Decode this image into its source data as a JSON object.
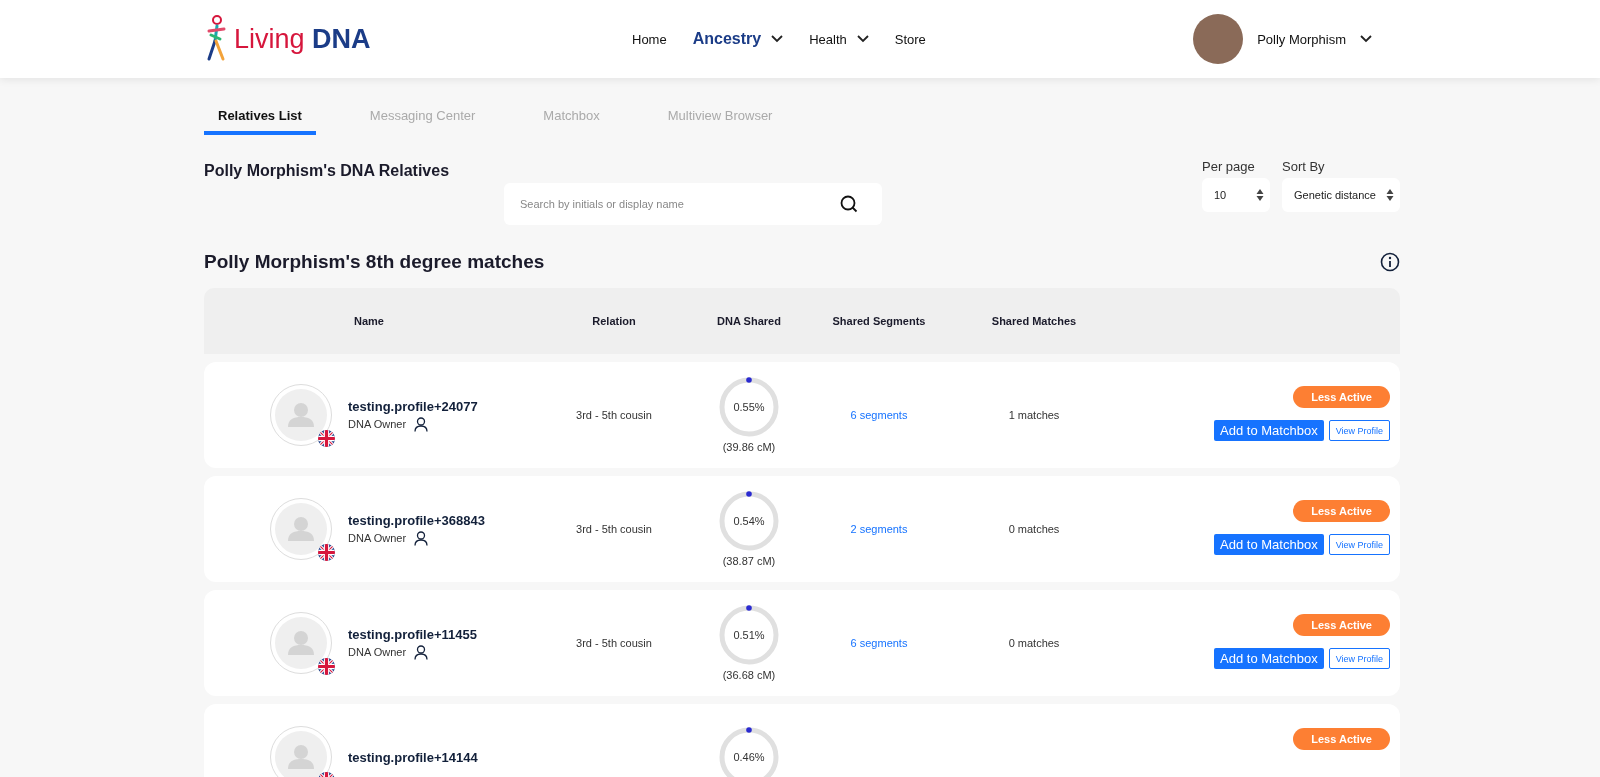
{
  "header": {
    "logo": {
      "word_1": "Living",
      "word_2": "DNA"
    },
    "nav": [
      {
        "label": "Home",
        "selected": false,
        "dropdown": false
      },
      {
        "label": "Ancestry",
        "selected": true,
        "dropdown": true
      },
      {
        "label": "Health",
        "selected": false,
        "dropdown": true
      },
      {
        "label": "Store",
        "selected": false,
        "dropdown": false
      }
    ],
    "user": {
      "name": "Polly Morphism"
    }
  },
  "tabs": [
    {
      "label": "Relatives List",
      "selected": true
    },
    {
      "label": "Messaging Center",
      "selected": false
    },
    {
      "label": "Matchbox",
      "selected": false
    },
    {
      "label": "Multiview Browser",
      "selected": false
    }
  ],
  "relatives_title": "Polly Morphism's DNA Relatives",
  "search": {
    "placeholder": "Search by initials or display name"
  },
  "per_page": {
    "label": "Per page",
    "value": "10"
  },
  "sort_by": {
    "label": "Sort By",
    "value": "Genetic distance"
  },
  "matches_title": "Polly Morphism's 8th degree matches",
  "table": {
    "columns": [
      "Name",
      "Relation",
      "DNA Shared",
      "Shared Segments",
      "Shared Matches"
    ],
    "rows": [
      {
        "name": "testing.profile+24077",
        "role": "DNA Owner",
        "relation": "3rd - 5th cousin",
        "percent": "0.55%",
        "cm": "(39.86 cM)",
        "segments": "6 segments",
        "matches": "1 matches",
        "status": "Less Active",
        "actions": [
          "Add to Matchbox",
          "View Profile"
        ]
      },
      {
        "name": "testing.profile+368843",
        "role": "DNA Owner",
        "relation": "3rd - 5th cousin",
        "percent": "0.54%",
        "cm": "(38.87 cM)",
        "segments": "2 segments",
        "matches": "0 matches",
        "status": "Less Active",
        "actions": [
          "Add to Matchbox",
          "View Profile"
        ]
      },
      {
        "name": "testing.profile+11455",
        "role": "DNA Owner",
        "relation": "3rd - 5th cousin",
        "percent": "0.51%",
        "cm": "(36.68 cM)",
        "segments": "6 segments",
        "matches": "0 matches",
        "status": "Less Active",
        "actions": [
          "Add to Matchbox",
          "View Profile"
        ]
      },
      {
        "name": "testing.profile+14144",
        "percent": "0.46%",
        "status": "Less Active"
      }
    ]
  }
}
